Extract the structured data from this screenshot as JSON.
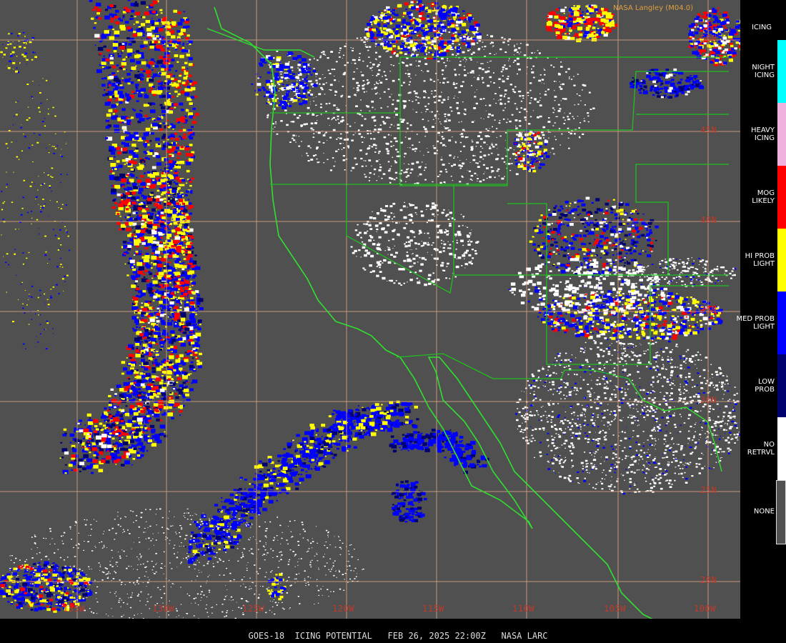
{
  "credit": "NASA Langley (M04.0)",
  "footer_text": "GOES-18  ICING POTENTIAL   FEB 26, 2025 22:00Z   NASA LARC",
  "grid": {
    "latitudes": [
      "50N",
      "45N",
      "40N",
      "35N",
      "30N",
      "25N",
      "20N"
    ],
    "longitudes": [
      "135W",
      "130W",
      "125W",
      "120W",
      "115W",
      "110W",
      "105W",
      "100W"
    ],
    "line_color": "#d8a080"
  },
  "legend": {
    "title": "ICING",
    "items": [
      {
        "label": "NIGHT\nICING",
        "color": "#00ffff"
      },
      {
        "label": "HEAVY\nICING",
        "color": "#f0b0e0"
      },
      {
        "label": "MOG\nLIKELY",
        "color": "#ff0000"
      },
      {
        "label": "HI PROB\nLIGHT",
        "color": "#ffff00"
      },
      {
        "label": "MED PROB\nLIGHT",
        "color": "#0000ff"
      },
      {
        "label": "LOW\nPROB",
        "color": "#00006e"
      },
      {
        "label": "NO\nRETRVL",
        "color": "#ffffff"
      },
      {
        "label": "NONE",
        "color": "#505050"
      }
    ]
  },
  "colors": {
    "background": "#505050",
    "coastline": "#30e030",
    "borders": "#20c020"
  }
}
